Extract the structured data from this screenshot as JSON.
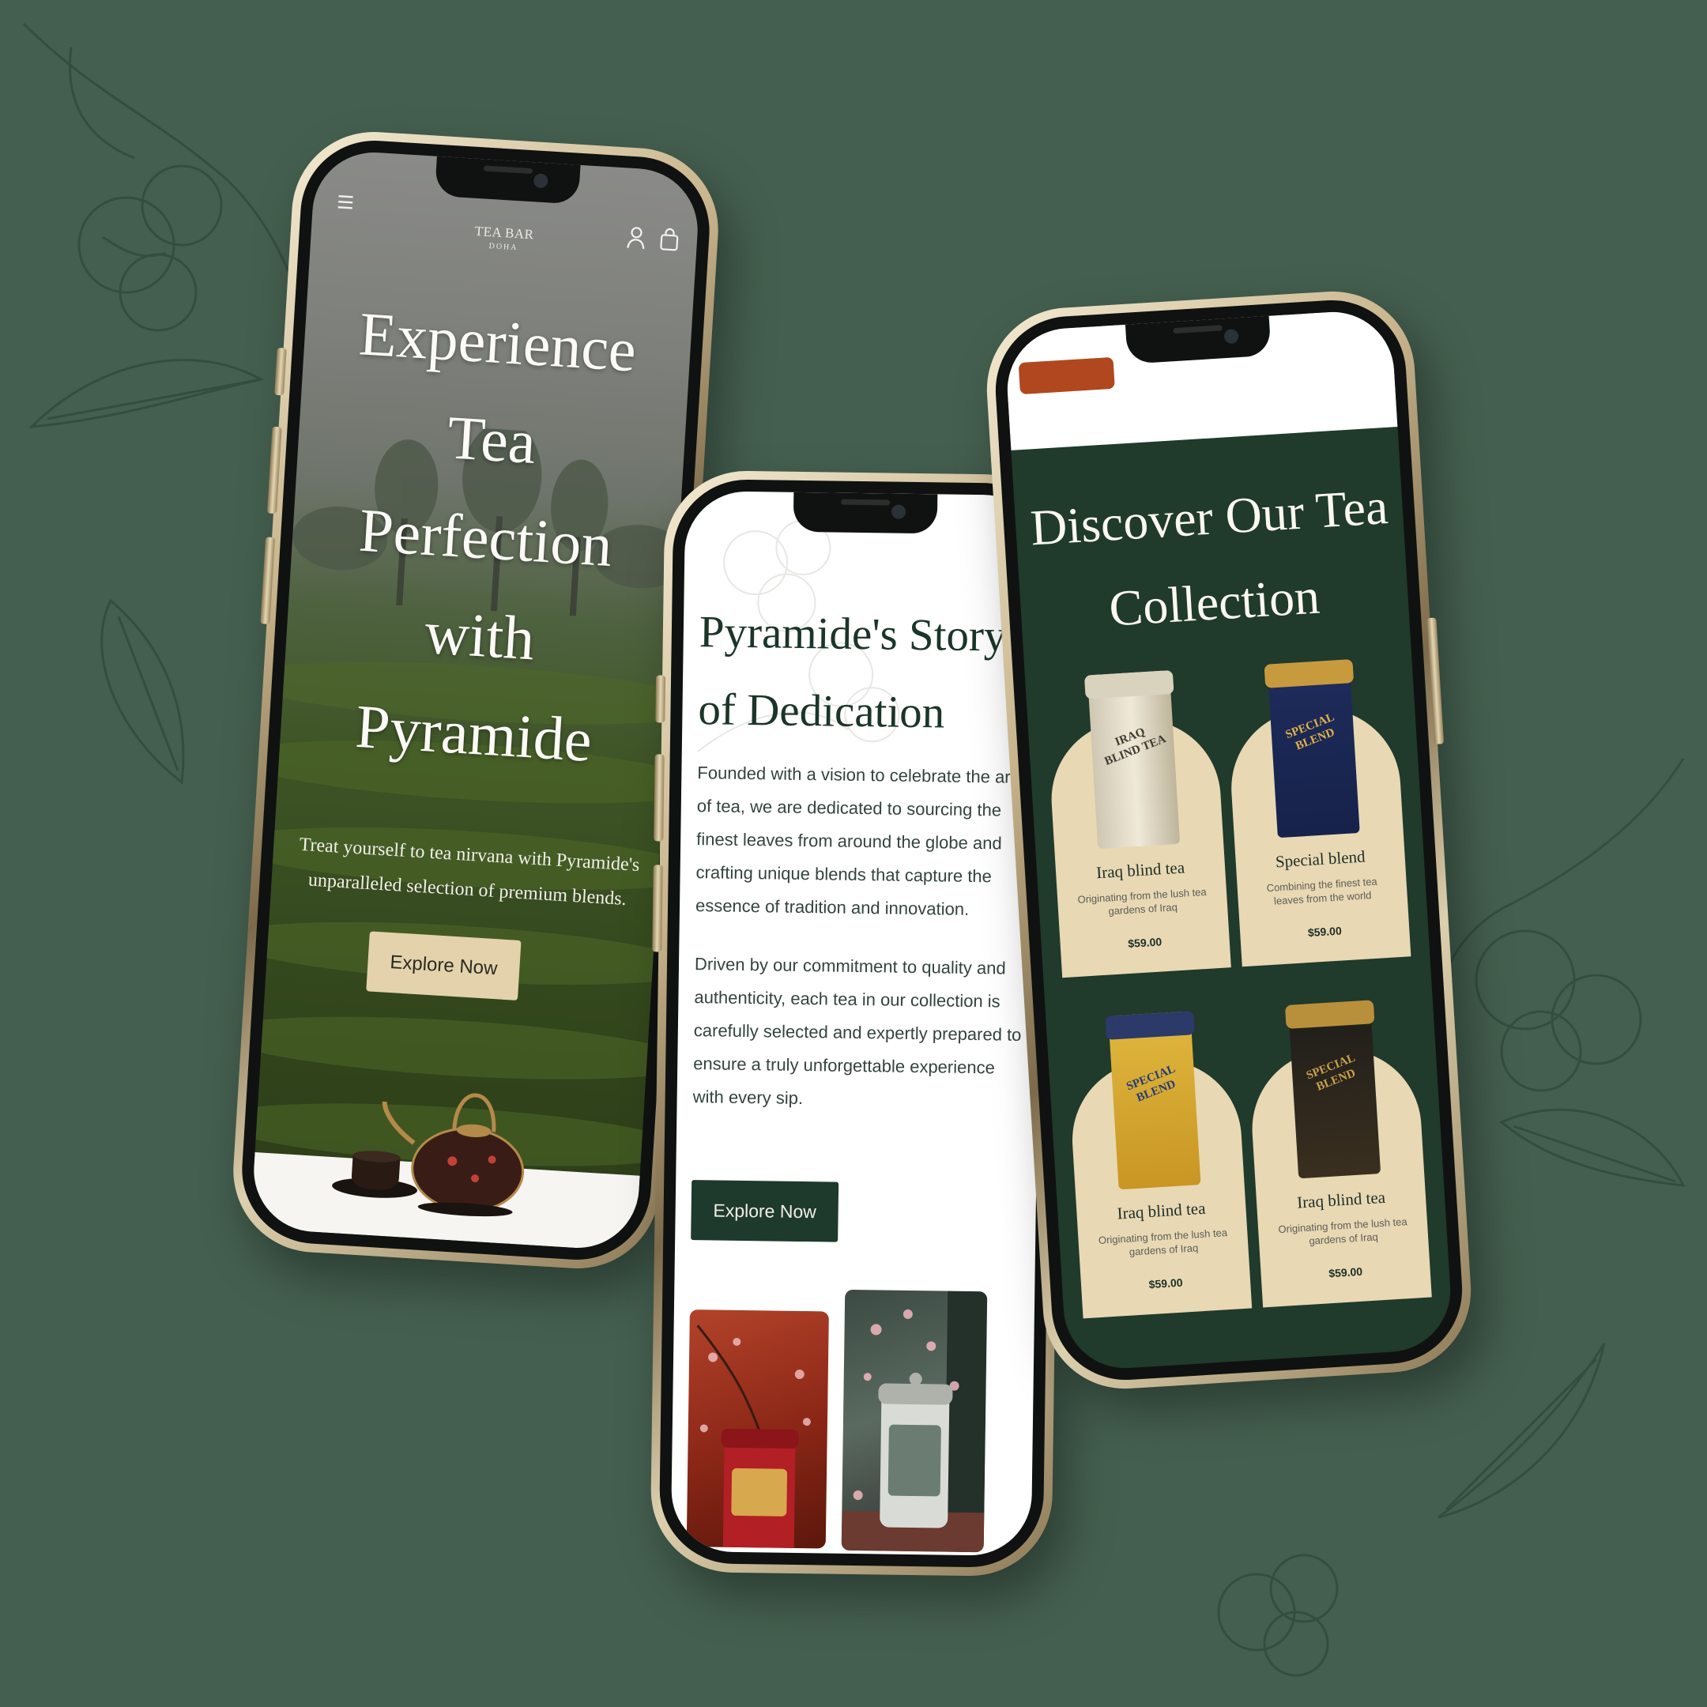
{
  "hero_screen": {
    "logo_text": "TEA BAR",
    "logo_sub": "DOHA",
    "title_lines": [
      "Experience",
      "Tea",
      "Perfection",
      "with",
      "Pyramide"
    ],
    "tagline": "Treat yourself to tea nirvana with Pyramide's unparalleled selection of premium blends.",
    "button_label": "Explore Now"
  },
  "story_screen": {
    "title": "Pyramide's Story of Dedication",
    "paragraph_1": "Founded with a vision to celebrate the art of tea, we are dedicated to sourcing the finest leaves from around the globe and crafting unique blends that capture the essence of tradition and innovation.",
    "paragraph_2": "Driven by our commitment to quality and authenticity, each tea in our collection is carefully selected and expertly prepared to ensure a truly unforgettable experience with every sip.",
    "button_label": "Explore Now"
  },
  "collection_screen": {
    "title": "Discover Our Tea Collection",
    "products": [
      {
        "name": "Iraq blind tea",
        "description": "Originating from the lush tea gardens of Iraq",
        "price": "$59.00",
        "tin_label": "IRAQ BLIND TEA"
      },
      {
        "name": "Special blend",
        "description": "Combining the finest tea leaves from the world",
        "price": "$59.00",
        "tin_label": "SPECIAL BLEND"
      },
      {
        "name": "Iraq blind tea",
        "description": "Originating from the lush tea gardens of Iraq",
        "price": "$59.00",
        "tin_label": "SPECIAL BLEND"
      },
      {
        "name": "Iraq blind tea",
        "description": "Originating from the lush tea gardens of Iraq",
        "price": "$59.00",
        "tin_label": "SPECIAL BLEND"
      }
    ]
  },
  "colors": {
    "background": "#445f4f",
    "dark_green": "#1d3a2c",
    "cream": "#e8d8b4",
    "gold_frame": "#c8b58d"
  },
  "icons": [
    "menu-icon",
    "user-icon",
    "bag-icon"
  ]
}
